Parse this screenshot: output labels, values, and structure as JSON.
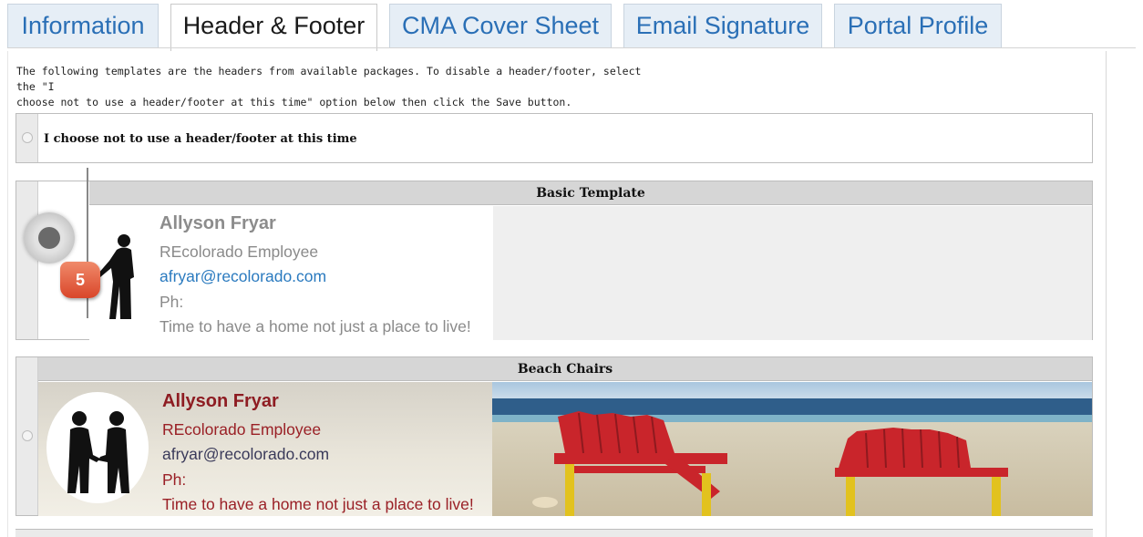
{
  "tabs": [
    {
      "label": "Information",
      "active": false
    },
    {
      "label": "Header & Footer",
      "active": true
    },
    {
      "label": "CMA Cover Sheet",
      "active": false
    },
    {
      "label": "Email Signature",
      "active": false
    },
    {
      "label": "Portal Profile",
      "active": false
    }
  ],
  "intro": {
    "line1": "The following templates are the headers from available packages. To disable a header/footer, select the \"I",
    "line2": "choose not to use a header/footer at this time\" option below then click the Save button."
  },
  "none_option": {
    "label": "I choose not to use a header/footer at this time"
  },
  "templates": [
    {
      "title": "Basic Template",
      "selected": true,
      "name": "Allyson Fryar",
      "role": "REcolorado Employee",
      "email": "afryar@recolorado.com",
      "phone": "Ph:",
      "tagline": "Time to have a home not just a place to live!"
    },
    {
      "title": "Beach Chairs",
      "selected": false,
      "name": "Allyson Fryar",
      "role": "REcolorado Employee",
      "email": "afryar@recolorado.com",
      "phone": "Ph:",
      "tagline": "Time to have a home not just a place to live!"
    }
  ],
  "step_badge": "5",
  "colors": {
    "tab_text": "#2a6fb6",
    "tab_bg": "#e6eef6",
    "basic_email": "#2a7abf",
    "beach_accent": "#8e1c22",
    "badge": "#d9462a"
  }
}
